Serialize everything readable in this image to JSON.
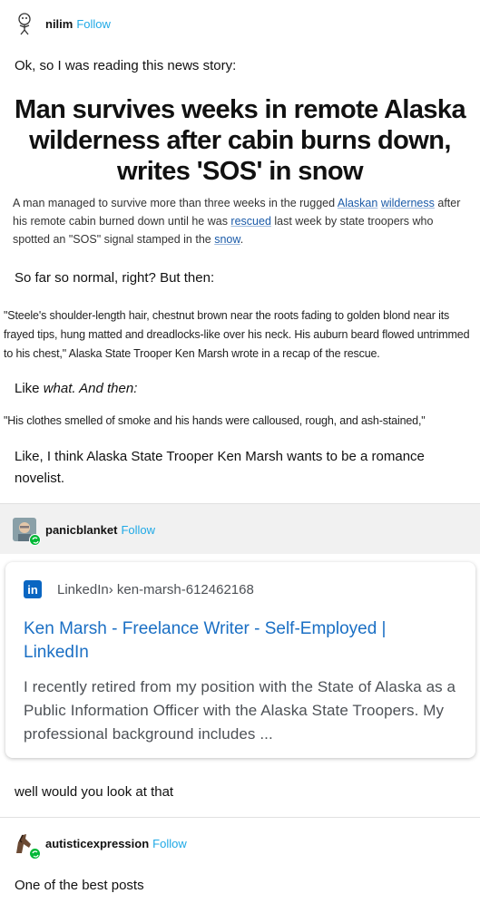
{
  "posts": [
    {
      "username": "nilim",
      "follow_label": "Follow",
      "avatar_icon": "doodle-figure-avatar",
      "intro_text": "Ok, so I was reading this news story:",
      "screenshot": {
        "headline": "Man survives weeks in remote Alaska wilderness after cabin burns down, writes 'SOS' in snow",
        "paragraph": {
          "p1": "A man managed to survive more than three weeks in the rugged ",
          "link1": "Alaskan",
          "p2": " ",
          "link2": "wilderness",
          "p3": " after his remote cabin burned down until he was ",
          "link3": "rescued",
          "p4": " last week by state troopers who spotted an \"SOS\" signal stamped in the ",
          "link4": "snow",
          "p5": "."
        }
      },
      "text2": "So far so normal, right? But then:",
      "quote1": "\"Steele's shoulder-length hair, chestnut brown near the roots fading to golden blond near its frayed tips, hung matted and dreadlocks-like over his neck. His auburn beard flowed untrimmed to his chest,\" Alaska State Trooper Ken Marsh wrote in a recap of the rescue.",
      "text3_plain": "Like ",
      "text3_italic": "what. And then:",
      "quote2": "\"His clothes smelled of smoke and his hands were calloused, rough, and ash-stained,\"",
      "text4": "Like, I think Alaska State Trooper Ken Marsh wants to be a romance novelist."
    },
    {
      "username": "panicblanket",
      "follow_label": "Follow",
      "avatar_icon": "photo-avatar",
      "card": {
        "source_name": "LinkedIn",
        "source_path": " › ken-marsh-612462168",
        "title": "Ken Marsh - Freelance Writer - Self-Employed | LinkedIn",
        "description": "I recently retired from my position with the State of Alaska as a Public Information Officer with the Alaska State Troopers. My professional background includes  ..."
      },
      "text": "well would you look at that"
    },
    {
      "username": "autisticexpression",
      "follow_label": "Follow",
      "avatar_icon": "horse-avatar",
      "text": "One of the best posts"
    }
  ],
  "colors": {
    "follow": "#1fa9e6",
    "link": "#1a6fc4",
    "reblog_badge": "#00b836",
    "linkedin": "#0a66c2"
  }
}
